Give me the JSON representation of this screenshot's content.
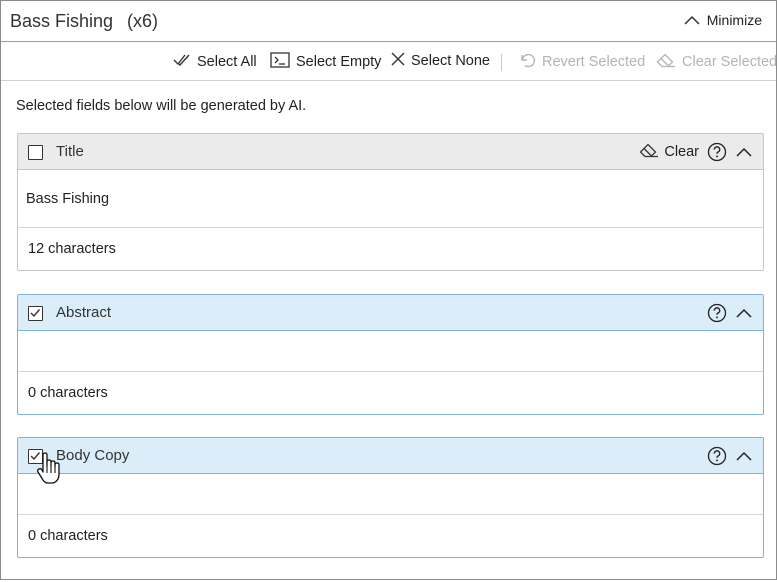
{
  "window": {
    "title": "Bass Fishing",
    "count": "(x6)",
    "minimize_label": "Minimize"
  },
  "toolbar": {
    "select_all": "Select All",
    "select_empty": "Select Empty",
    "select_none": "Select None",
    "revert_selected": "Revert Selected",
    "clear_selected": "Clear Selected"
  },
  "note": "Selected fields below will be generated by AI.",
  "fields": [
    {
      "label": "Title",
      "checked": false,
      "value": "Bass Fishing",
      "char_count": "12 characters",
      "clear_label": "Clear"
    },
    {
      "label": "Abstract",
      "checked": true,
      "value": "",
      "char_count": "0 characters"
    },
    {
      "label": "Body Copy",
      "checked": true,
      "value": "",
      "char_count": "0 characters"
    }
  ],
  "colors": {
    "selected_header": "#dcedfa",
    "selected_border": "#7fb3dd",
    "unselected_header": "#ebebeb",
    "disabled_text": "#b3b3b3"
  }
}
